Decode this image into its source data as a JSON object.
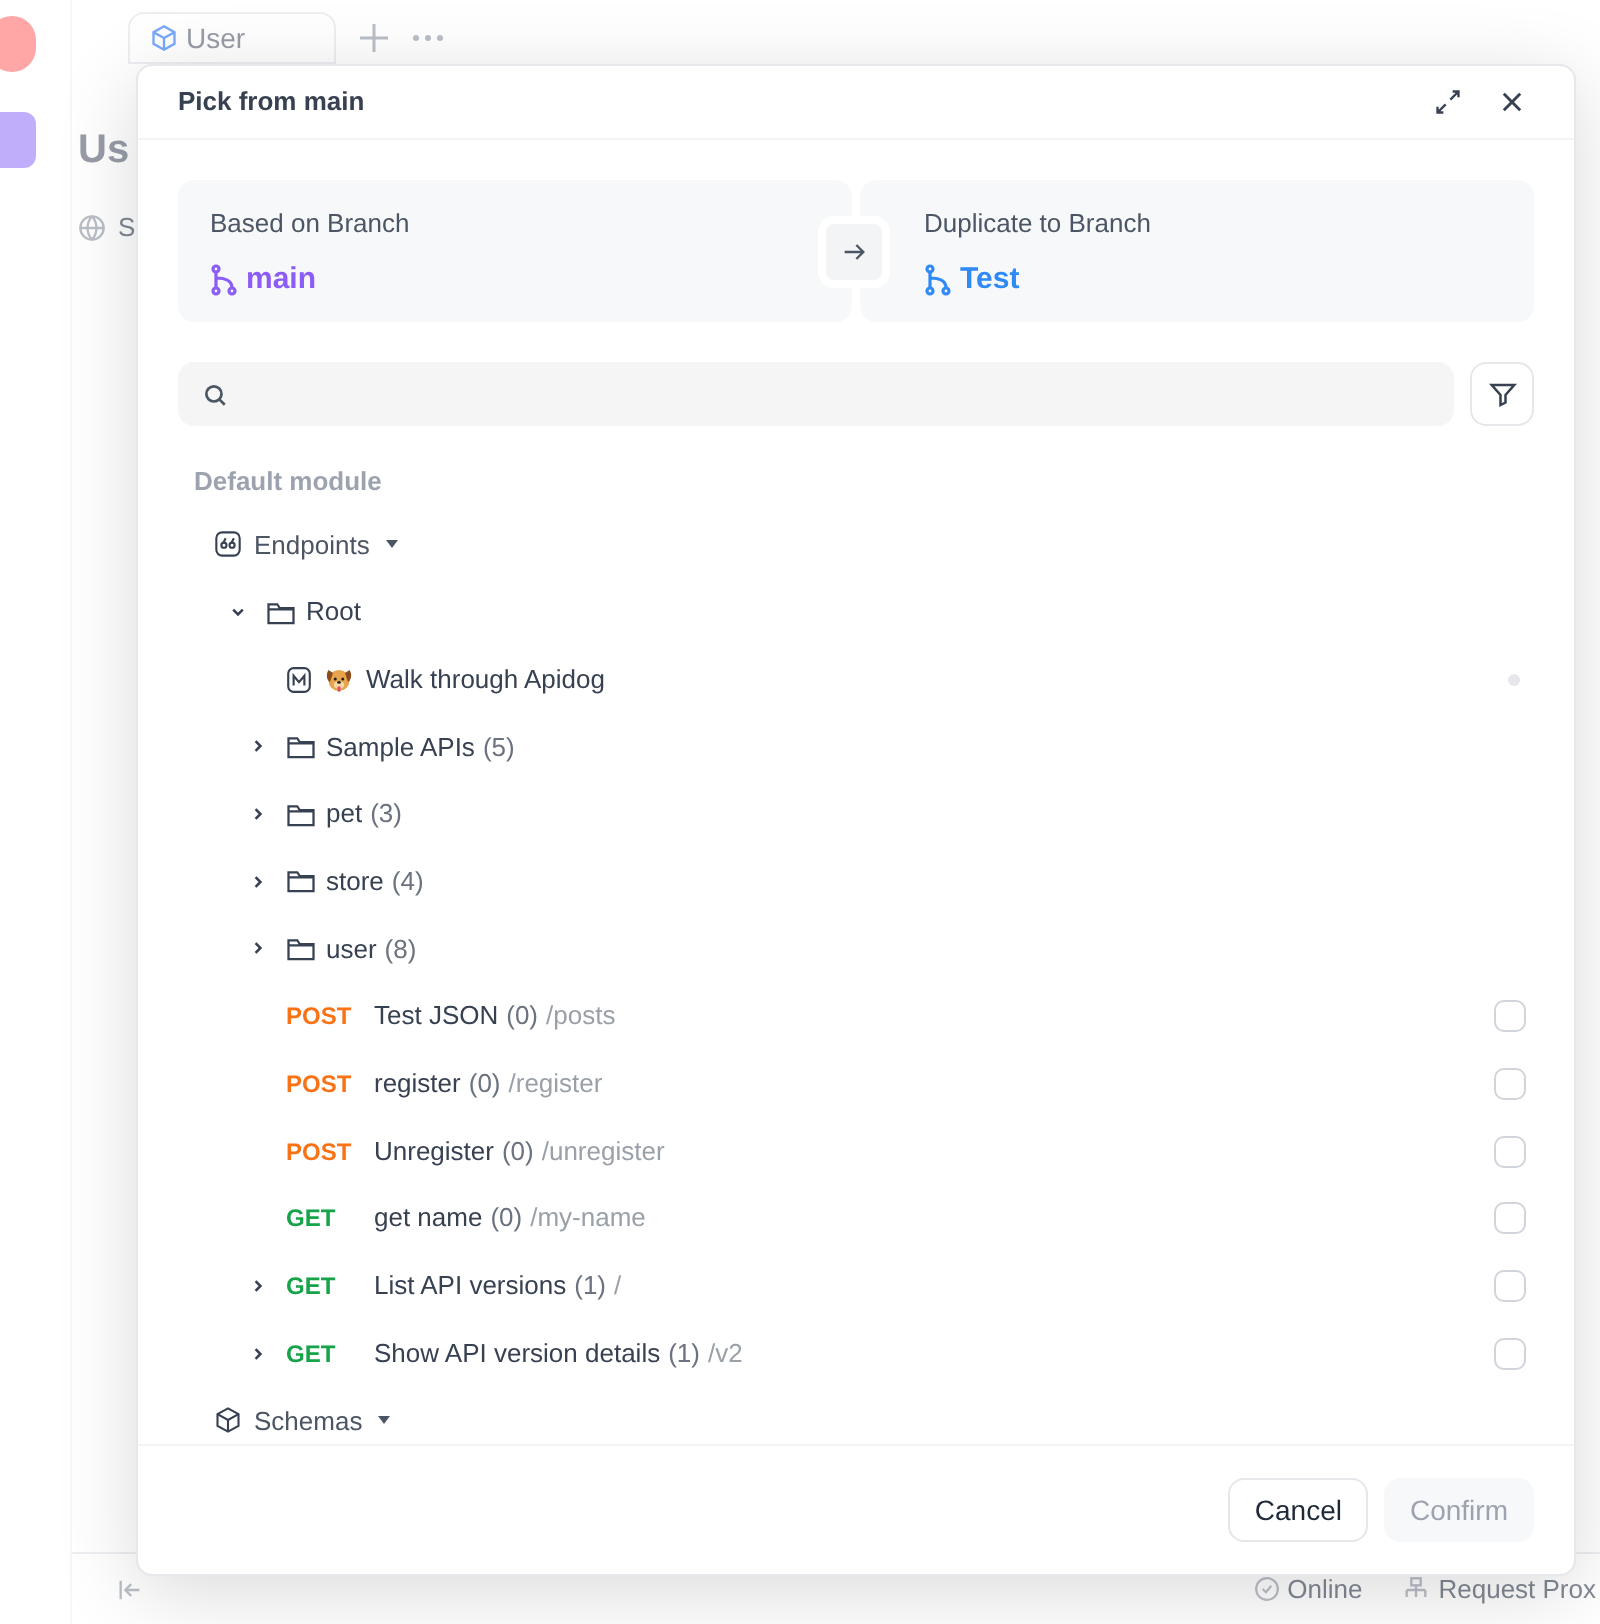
{
  "background": {
    "tab": {
      "label": "User"
    },
    "heading": "Us",
    "subtitle": "S",
    "status_bar": {
      "online": "Online",
      "proxy": "Request Prox"
    }
  },
  "dialog": {
    "title": "Pick from main",
    "source": {
      "label": "Based on Branch",
      "branch": "main"
    },
    "target": {
      "label": "Duplicate to Branch",
      "branch": "Test"
    },
    "module": "Default module",
    "tree": [
      {
        "kind": "group",
        "name": "Endpoints",
        "children": [
          {
            "kind": "folder",
            "name": "Root",
            "expanded": true,
            "children": [
              {
                "kind": "doc",
                "name": "Walk through Apidog"
              },
              {
                "kind": "folder",
                "name": "Sample APIs",
                "count": "(5)",
                "expanded": false
              },
              {
                "kind": "folder",
                "name": "pet",
                "count": "(3)",
                "expanded": false
              },
              {
                "kind": "folder",
                "name": "store",
                "count": "(4)",
                "expanded": false
              },
              {
                "kind": "folder",
                "name": "user",
                "count": "(8)",
                "expanded": false
              },
              {
                "kind": "endpoint",
                "method": "POST",
                "name": "Test JSON",
                "count": "(0)",
                "path": "/posts",
                "checked": false
              },
              {
                "kind": "endpoint",
                "method": "POST",
                "name": "register",
                "count": "(0)",
                "path": "/register",
                "checked": false
              },
              {
                "kind": "endpoint",
                "method": "POST",
                "name": "Unregister",
                "count": "(0)",
                "path": "/unregister",
                "checked": false
              },
              {
                "kind": "endpoint",
                "method": "GET",
                "name": "get name",
                "count": "(0)",
                "path": "/my-name",
                "checked": false
              },
              {
                "kind": "endpoint",
                "method": "GET",
                "name": "List API versions",
                "count": "(1)",
                "path": "/",
                "checked": false,
                "expanded": false
              },
              {
                "kind": "endpoint",
                "method": "GET",
                "name": "Show API version details",
                "count": "(1)",
                "path": "/v2",
                "checked": false,
                "expanded": false
              }
            ]
          }
        ]
      },
      {
        "kind": "group",
        "name": "Schemas"
      }
    ],
    "buttons": [
      {
        "label": "Cancel",
        "disabled": false
      },
      {
        "label": "Confirm",
        "disabled": true
      }
    ]
  }
}
